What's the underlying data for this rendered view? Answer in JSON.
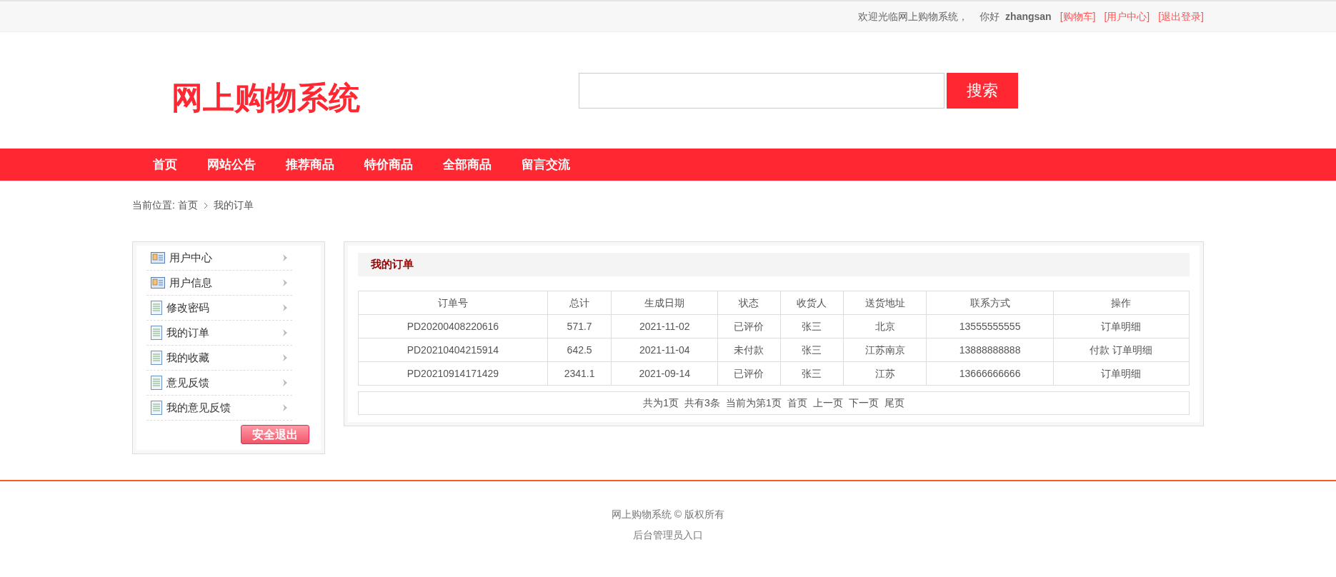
{
  "top_bar": {
    "welcome": "欢迎光临网上购物系统，",
    "greeting": "你好",
    "username": "zhangsan",
    "links": [
      "[购物车]",
      "[用户中心]",
      "[退出登录]"
    ]
  },
  "header": {
    "logo": "网上购物系统",
    "search_button": "搜索"
  },
  "nav": [
    "首页",
    "网站公告",
    "推荐商品",
    "特价商品",
    "全部商品",
    "留言交流"
  ],
  "breadcrumb": {
    "label": "当前位置:",
    "items": [
      "首页",
      "我的订单"
    ]
  },
  "sidebar": {
    "items": [
      {
        "label": "用户中心",
        "kind": "card"
      },
      {
        "label": "用户信息",
        "kind": "card"
      },
      {
        "label": "修改密码",
        "kind": "doc"
      },
      {
        "label": "我的订单",
        "kind": "doc"
      },
      {
        "label": "我的收藏",
        "kind": "doc"
      },
      {
        "label": "意见反馈",
        "kind": "doc"
      },
      {
        "label": "我的意见反馈",
        "kind": "doc"
      }
    ],
    "logout_button": "安全退出"
  },
  "orders": {
    "title": "我的订单",
    "columns": [
      "订单号",
      "总计",
      "生成日期",
      "状态",
      "收货人",
      "送货地址",
      "联系方式",
      "操作"
    ],
    "rows": [
      {
        "cells": [
          "PD20200408220616",
          "571.7",
          "2021-11-02",
          "已评价",
          "张三",
          "北京",
          "13555555555"
        ],
        "actions": [
          "订单明细"
        ]
      },
      {
        "cells": [
          "PD20210404215914",
          "642.5",
          "2021-11-04",
          "未付款",
          "张三",
          "江苏南京",
          "13888888888"
        ],
        "actions": [
          "付款",
          "订单明细"
        ]
      },
      {
        "cells": [
          "PD20210914171429",
          "2341.1",
          "2021-09-14",
          "已评价",
          "张三",
          "江苏",
          "13666666666"
        ],
        "actions": [
          "订单明细"
        ]
      }
    ],
    "pagination": {
      "info": [
        "共为1页",
        "共有3条",
        "当前为第1页"
      ],
      "links": [
        "首页",
        "上一页",
        "下一页",
        "尾页"
      ]
    }
  },
  "footer": {
    "copyright": "网上购物系统 © 版权所有",
    "admin_link": "后台管理员入口"
  }
}
